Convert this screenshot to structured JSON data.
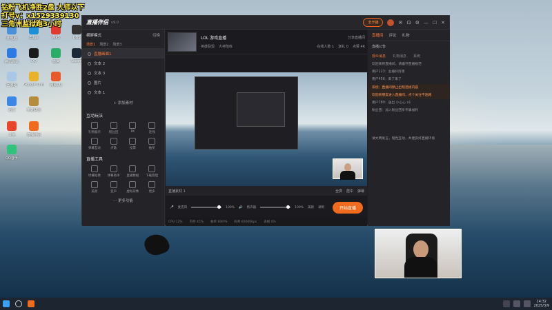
{
  "overlay": {
    "line1": "钻粉飞机净胜2盘 大师以下",
    "line2": "打号v：x1529339130",
    "line3": "三角洲监狱跑3小时"
  },
  "desktop": {
    "icons": [
      {
        "label": "此电脑",
        "color": "#4a90d9"
      },
      {
        "label": "Edge",
        "color": "#1e8fd6"
      },
      {
        "label": "WPS",
        "color": "#e23a2f"
      },
      {
        "label": "OBS",
        "color": "#333333"
      },
      {
        "label": "腾讯会议",
        "color": "#2c7be5"
      },
      {
        "label": "QQ",
        "color": "#1a1a1a"
      },
      {
        "label": "微信",
        "color": "#2aae67"
      },
      {
        "label": "Steam",
        "color": "#1b2838"
      },
      {
        "label": "回收站",
        "color": "#a9c8e8"
      },
      {
        "label": "Google Chrome",
        "color": "#e8b32a"
      },
      {
        "label": "网易UU",
        "color": "#e85a2a"
      },
      {
        "label": "迅雷",
        "color": "#3c87e6"
      },
      {
        "label": "英雄联盟",
        "color": "#b48c3c"
      },
      {
        "label": "斗鱼",
        "color": "#e8462a"
      },
      {
        "label": "直播伴侣",
        "color": "#f06b1d"
      },
      {
        "label": "QQ音乐",
        "color": "#31c27c"
      }
    ]
  },
  "app": {
    "name": "直播伴侣",
    "version": "v9.0",
    "go_live_short": "去开播",
    "left": {
      "header": "横屏模式",
      "header_right": "切换",
      "tabs": [
        "场景1",
        "场景2",
        "场景3"
      ],
      "scenes": [
        "直播画面1",
        "文本 2",
        "文本 3",
        "图片",
        "文本 1"
      ],
      "add_source": "+ 添加素材",
      "interaction_title": "互动玩法",
      "interaction_tools": [
        "礼物展示",
        "粉丝团",
        "PK",
        "连线",
        "弹幕互动",
        "点歌",
        "投票",
        "抽奖"
      ],
      "live_tools_title": "直播工具",
      "live_tools": [
        "绿幕抠像",
        "弹幕助手",
        "直播数据",
        "下载管理",
        "美颜",
        "变声",
        "虚拟形象",
        "更多"
      ],
      "more_tools": "··· 更多功能"
    },
    "center": {
      "room_title": "LOL 游戏直播",
      "room_meta": [
        "英雄联盟",
        "大神陪练"
      ],
      "room_right": [
        "分享直播间",
        "设置"
      ],
      "stats": [
        "在线人数 1",
        "送礼 0",
        "点赞 4K"
      ],
      "bar": [
        "直播素材 1",
        "全屏",
        "居中",
        "弹幕"
      ],
      "mixer": [
        "麦克风",
        "100%",
        "扬声器",
        "100%",
        "美颜",
        "录制",
        "设置"
      ],
      "live_button": "开始直播",
      "status": [
        "CPU 12%",
        "内存 45%",
        "帧率 60FPS",
        "码率 6000Kbps",
        "丢帧 0%"
      ]
    },
    "right": {
      "tabs": [
        "直播间",
        "评论",
        "礼物"
      ],
      "section": "直播公告",
      "subtabs": [
        "观众消息",
        "礼物消息",
        "系统"
      ],
      "chat": [
        "欢迎来到直播间，请遵守直播规范",
        "用户123：主播好厉害",
        "用户456：来了来了",
        "系统：直播间禁止出现违规内容",
        "欢迎新朋友进入直播间，点个关注不迷路",
        "用户789：送出 小心心 x1",
        "粉丝团：加入粉丝团享专属福利"
      ],
      "footer": "请文明发言，理性互动，共建良好直播环境"
    }
  },
  "taskbar": {
    "time": "14:32",
    "date": "2025/3/9"
  }
}
